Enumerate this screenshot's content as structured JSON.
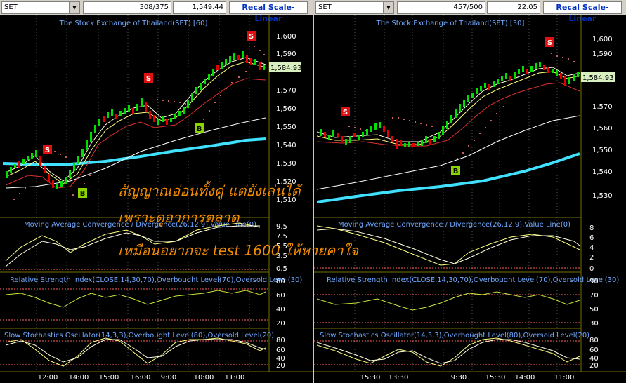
{
  "left": {
    "symbol": "SET",
    "counter": "308/375",
    "price": "1,549.44",
    "scale_button": "Recal Scale-Linear",
    "title": "The Stock Exchange of Thailand(SET) [60]",
    "price_badge": "1,584.93",
    "price_ticks": [
      "1,600",
      "1,590",
      "1,580",
      "1,570",
      "1,560",
      "1,550",
      "1,540",
      "1,530",
      "1,520",
      "1,510"
    ],
    "macd_label": "Moving Average Convergence / Divergence(26,12,9),Value Line(0)",
    "macd_ticks": [
      "9.5",
      "7.5",
      "5.5",
      "3.5",
      "1.5",
      "0.5"
    ],
    "rsi_label": "Relative Strength Index(CLOSE,14,30,70),Overbought Level(70),Oversold Level(30)",
    "rsi_ticks": [
      "80",
      "60",
      "40",
      "20"
    ],
    "stoch_label": "Slow Stochastics Oscillator(14,3,3),Overbought Level(80),Oversold Level(20)",
    "stoch_ticks": [
      "80",
      "60",
      "40",
      "20"
    ],
    "time_ticks": [
      "12:00",
      "14:00",
      "15:00",
      "16:00",
      "9:00",
      "10:00",
      "11:00"
    ],
    "signals": [
      "S",
      "B",
      "S",
      "B",
      "S"
    ]
  },
  "right": {
    "symbol": "SET",
    "counter": "457/500",
    "price": "22.05",
    "scale_button": "Recal Scale-Linear",
    "title": "The Stock Exchange of Thailand(SET) [30]",
    "price_badge": "1,584.93",
    "price_ticks": [
      "1,600",
      "1,590",
      "1,580",
      "1,570",
      "1,560",
      "1,550",
      "1,540",
      "1,530"
    ],
    "macd_label": "Moving Average Convergence / Divergence(26,12,9),Value Line(0)",
    "macd_ticks": [
      "8",
      "6",
      "4",
      "2",
      "0"
    ],
    "rsi_label": "Relative Strength Index(CLOSE,14,30,70),Overbought Level(70),Oversold Level(30)",
    "rsi_ticks": [
      "90",
      "70",
      "50",
      "30"
    ],
    "stoch_label": "Slow Stochastics Oscillator(14,3,3),Overbought Level(80),Oversold Level(20)",
    "stoch_ticks": [
      "80",
      "60",
      "40",
      "20"
    ],
    "time_ticks": [
      "15:30",
      "13:30",
      "9:30",
      "15:30",
      "14:00",
      "11:00"
    ],
    "signals": [
      "S",
      "B",
      "S"
    ]
  },
  "overlay": {
    "line1": "สัญญาณอ่อนทั้งคู่ แต่ยังเล่นได้",
    "line2": "เพราะดูอาการตลาด",
    "line3": "เหมือนอยากจะ test 1600 ให้หายคาใจ"
  },
  "colors": {
    "accent_text": "#6fa8ff",
    "overlay_text": "#f28c00",
    "sell_signal": "#e01010",
    "buy_signal": "#8bd400",
    "bull_candle": "#00e000",
    "bear_candle": "#e00000",
    "long_ma": "#40e0ff"
  }
}
